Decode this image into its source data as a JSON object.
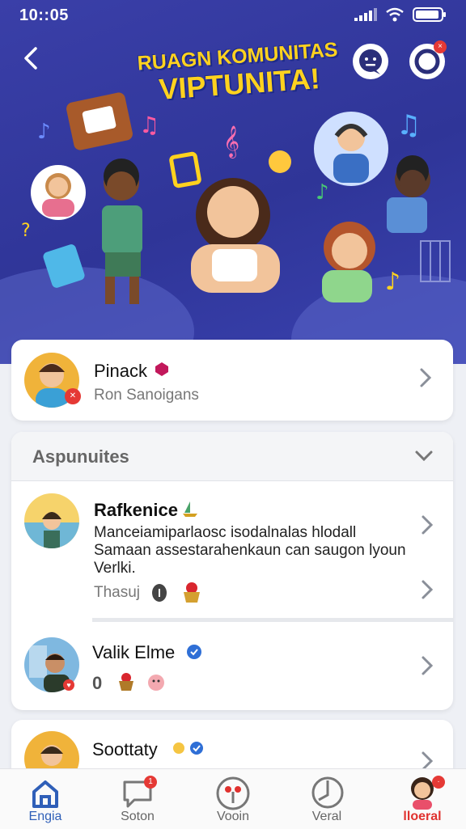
{
  "status_bar": {
    "time": "10::05"
  },
  "hero": {
    "title_line1": "RUAGN KOMUNITAS",
    "title_line2": "VIPTUNITA!"
  },
  "profile_card": {
    "name": "Pinack",
    "subtitle": "Ron Sanoigans"
  },
  "section": {
    "title": "Aspunuites"
  },
  "posts": [
    {
      "name": "Rafkenice",
      "body_line1": "Manceiamiparlaosc isodalnalas hlodall",
      "body_line2": "Samaan assestarahenkaun can saugon lyoun",
      "body_line3": "Verlki.",
      "meta": "Thasuj"
    },
    {
      "name": "Valik Elme",
      "meta": "0"
    },
    {
      "name": "Soottaty"
    }
  ],
  "tabs": [
    {
      "label": "Engia",
      "icon": "home-icon",
      "active": true
    },
    {
      "label": "Soton",
      "icon": "chat-icon",
      "active": false
    },
    {
      "label": "Vooin",
      "icon": "voice-icon",
      "active": false
    },
    {
      "label": "Veral",
      "icon": "music-icon",
      "active": false
    },
    {
      "label": "lloeral",
      "icon": "profile-avatar-icon",
      "active": false
    }
  ],
  "colors": {
    "hero_bg": "#3238a0",
    "title_yellow": "#ffd21f",
    "accent_blue": "#2f6fd6",
    "badge_red": "#e53935",
    "tab_active_red": "#e0322f"
  }
}
